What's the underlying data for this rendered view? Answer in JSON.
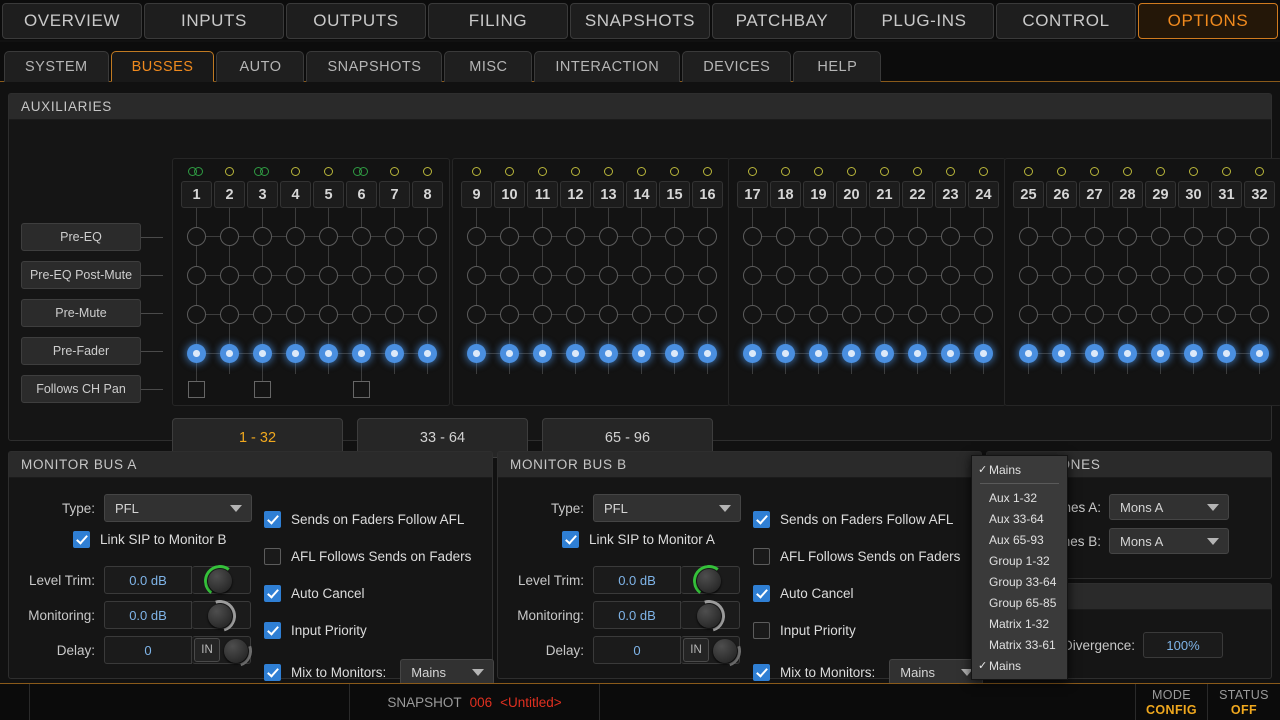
{
  "topnav": {
    "items": [
      {
        "label": "OVERVIEW",
        "active": false
      },
      {
        "label": "INPUTS",
        "active": false
      },
      {
        "label": "OUTPUTS",
        "active": false
      },
      {
        "label": "FILING",
        "active": false
      },
      {
        "label": "SNAPSHOTS",
        "active": false
      },
      {
        "label": "PATCHBAY",
        "active": false
      },
      {
        "label": "PLUG-INS",
        "active": false
      },
      {
        "label": "CONTROL",
        "active": false
      },
      {
        "label": "OPTIONS",
        "active": true
      }
    ]
  },
  "subnav": {
    "items": [
      {
        "label": "SYSTEM",
        "active": false
      },
      {
        "label": "BUSSES",
        "active": true
      },
      {
        "label": "AUTO",
        "active": false
      },
      {
        "label": "SNAPSHOTS",
        "active": false
      },
      {
        "label": "MISC",
        "active": false
      },
      {
        "label": "INTERACTION",
        "active": false
      },
      {
        "label": "DEVICES",
        "active": false
      },
      {
        "label": "HELP",
        "active": false
      }
    ]
  },
  "auxiliaries": {
    "title": "AUXILIARIES",
    "mode_buttons": [
      {
        "label": "Pre-EQ"
      },
      {
        "label": "Pre-EQ Post-Mute"
      },
      {
        "label": "Pre-Mute"
      },
      {
        "label": "Pre-Fader"
      },
      {
        "label": "Follows CH Pan"
      }
    ],
    "active_mode": "Pre-Fader",
    "groups": [
      {
        "channels": [
          {
            "num": "1",
            "stereo": true,
            "mode": "Pre-Fader",
            "pan": true
          },
          {
            "num": "2",
            "stereo": false,
            "mode": "Pre-Fader",
            "pan": false
          },
          {
            "num": "3",
            "stereo": true,
            "mode": "Pre-Fader",
            "pan": true
          },
          {
            "num": "4",
            "stereo": false,
            "mode": "Pre-Fader",
            "pan": false
          },
          {
            "num": "5",
            "stereo": false,
            "mode": "Pre-Fader",
            "pan": false
          },
          {
            "num": "6",
            "stereo": true,
            "mode": "Pre-Fader",
            "pan": true
          },
          {
            "num": "7",
            "stereo": false,
            "mode": "Pre-Fader",
            "pan": false
          },
          {
            "num": "8",
            "stereo": false,
            "mode": "Pre-Fader",
            "pan": false
          }
        ]
      },
      {
        "channels": [
          {
            "num": "9",
            "stereo": false,
            "mode": "Pre-Fader",
            "pan": false
          },
          {
            "num": "10",
            "stereo": false,
            "mode": "Pre-Fader",
            "pan": false
          },
          {
            "num": "11",
            "stereo": false,
            "mode": "Pre-Fader",
            "pan": false
          },
          {
            "num": "12",
            "stereo": false,
            "mode": "Pre-Fader",
            "pan": false
          },
          {
            "num": "13",
            "stereo": false,
            "mode": "Pre-Fader",
            "pan": false
          },
          {
            "num": "14",
            "stereo": false,
            "mode": "Pre-Fader",
            "pan": false
          },
          {
            "num": "15",
            "stereo": false,
            "mode": "Pre-Fader",
            "pan": false
          },
          {
            "num": "16",
            "stereo": false,
            "mode": "Pre-Fader",
            "pan": false
          }
        ]
      },
      {
        "channels": [
          {
            "num": "17",
            "stereo": false,
            "mode": "Pre-Fader",
            "pan": false
          },
          {
            "num": "18",
            "stereo": false,
            "mode": "Pre-Fader",
            "pan": false
          },
          {
            "num": "19",
            "stereo": false,
            "mode": "Pre-Fader",
            "pan": false
          },
          {
            "num": "20",
            "stereo": false,
            "mode": "Pre-Fader",
            "pan": false
          },
          {
            "num": "21",
            "stereo": false,
            "mode": "Pre-Fader",
            "pan": false
          },
          {
            "num": "22",
            "stereo": false,
            "mode": "Pre-Fader",
            "pan": false
          },
          {
            "num": "23",
            "stereo": false,
            "mode": "Pre-Fader",
            "pan": false
          },
          {
            "num": "24",
            "stereo": false,
            "mode": "Pre-Fader",
            "pan": false
          }
        ]
      },
      {
        "channels": [
          {
            "num": "25",
            "stereo": false,
            "mode": "Pre-Fader",
            "pan": false
          },
          {
            "num": "26",
            "stereo": false,
            "mode": "Pre-Fader",
            "pan": false
          },
          {
            "num": "27",
            "stereo": false,
            "mode": "Pre-Fader",
            "pan": false
          },
          {
            "num": "28",
            "stereo": false,
            "mode": "Pre-Fader",
            "pan": false
          },
          {
            "num": "29",
            "stereo": false,
            "mode": "Pre-Fader",
            "pan": false
          },
          {
            "num": "30",
            "stereo": false,
            "mode": "Pre-Fader",
            "pan": false
          },
          {
            "num": "31",
            "stereo": false,
            "mode": "Pre-Fader",
            "pan": false
          },
          {
            "num": "32",
            "stereo": false,
            "mode": "Pre-Fader",
            "pan": false
          }
        ]
      }
    ],
    "range_buttons": [
      {
        "label": "1 - 32",
        "active": true
      },
      {
        "label": "33 - 64",
        "active": false
      },
      {
        "label": "65 - 96",
        "active": false
      }
    ]
  },
  "monitor_a": {
    "title": "MONITOR BUS A",
    "type_label": "Type:",
    "type_value": "PFL",
    "link_label": "Link SIP to Monitor B",
    "link_checked": true,
    "level_trim_label": "Level Trim:",
    "level_trim_value": "0.0 dB",
    "monitoring_label": "Monitoring:",
    "monitoring_value": "0.0 dB",
    "delay_label": "Delay:",
    "delay_value": "0",
    "in_label": "IN",
    "options": [
      {
        "label": "Sends on Faders Follow AFL",
        "checked": true
      },
      {
        "label": "AFL Follows Sends on Faders",
        "checked": false
      },
      {
        "label": "Auto Cancel",
        "checked": true
      },
      {
        "label": "Input Priority",
        "checked": true
      }
    ],
    "mix_label": "Mix to Monitors:",
    "mix_checked": true,
    "mix_value": "Mains"
  },
  "monitor_b": {
    "title": "MONITOR BUS B",
    "type_label": "Type:",
    "type_value": "PFL",
    "link_label": "Link SIP to Monitor A",
    "link_checked": true,
    "level_trim_label": "Level Trim:",
    "level_trim_value": "0.0 dB",
    "monitoring_label": "Monitoring:",
    "monitoring_value": "0.0 dB",
    "delay_label": "Delay:",
    "delay_value": "0",
    "in_label": "IN",
    "options": [
      {
        "label": "Sends on Faders Follow AFL",
        "checked": true
      },
      {
        "label": "AFL Follows Sends on Faders",
        "checked": false
      },
      {
        "label": "Auto Cancel",
        "checked": true
      },
      {
        "label": "Input Priority",
        "checked": false
      }
    ],
    "mix_label": "Mix to Monitors:",
    "mix_checked": true,
    "mix_value": "Mains"
  },
  "headphones": {
    "title": "HEADPHONES",
    "a_label": "Headphones A:",
    "a_value": "Mons A",
    "b_label": "Headphones B:",
    "b_value": "Mons A"
  },
  "divergence": {
    "title": "",
    "label": "Center Divergence:",
    "value": "100%"
  },
  "dropdown": {
    "items": [
      {
        "label": "Mains",
        "checked": true,
        "sep_after": true
      },
      {
        "label": "Aux 1-32",
        "checked": false,
        "sep_after": false
      },
      {
        "label": "Aux 33-64",
        "checked": false,
        "sep_after": false
      },
      {
        "label": "Aux 65-93",
        "checked": false,
        "sep_after": false
      },
      {
        "label": "Group 1-32",
        "checked": false,
        "sep_after": false
      },
      {
        "label": "Group 33-64",
        "checked": false,
        "sep_after": false
      },
      {
        "label": "Group 65-85",
        "checked": false,
        "sep_after": false
      },
      {
        "label": "Matrix 1-32",
        "checked": false,
        "sep_after": false
      },
      {
        "label": "Matrix 33-61",
        "checked": false,
        "sep_after": false
      },
      {
        "label": "Mains",
        "checked": true,
        "sep_after": false
      }
    ]
  },
  "statusbar": {
    "snapshot_label": "SNAPSHOT",
    "snapshot_number": "006",
    "snapshot_name": "<Untitled>",
    "mode_key": "MODE",
    "mode_value": "CONFIG",
    "status_key": "STATUS",
    "status_value": "OFF"
  },
  "colors": {
    "accent_orange": "#f08a1e",
    "active_node_blue": "#4a8fe0",
    "checkbox_blue": "#2f7fd4",
    "stereo_green": "#2f9b43",
    "mono_yellow": "#b9b63a",
    "value_blue": "#7fb4e8",
    "status_red": "#e03020"
  }
}
